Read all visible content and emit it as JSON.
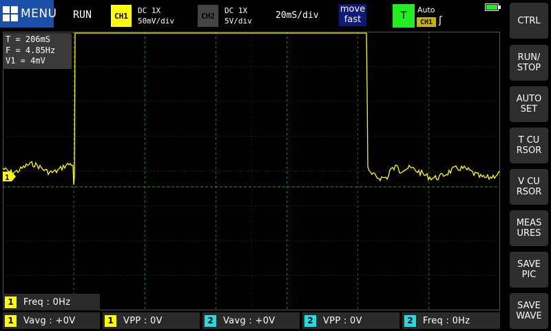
{
  "topbar": {
    "menu_label": "MENU",
    "run_state": "RUN",
    "ch1": {
      "badge": "CH1",
      "coupling": "DC  1X",
      "scale": "50mV/div",
      "color": "#ffff00"
    },
    "ch2": {
      "badge": "CH2",
      "coupling": "DC  1X",
      "scale": "5V/div",
      "color": "#444444"
    },
    "timebase": "20mS/div",
    "move": {
      "line1": "move",
      "line2": "fast"
    },
    "trigger": {
      "badge": "T",
      "mode": "Auto",
      "source": "CH1",
      "edge_icon": "rising-edge-icon"
    },
    "battery_icon": "battery-icon"
  },
  "side_buttons": [
    {
      "id": "ctrl",
      "line1": "CTRL",
      "line2": ""
    },
    {
      "id": "run-stop",
      "line1": "RUN/",
      "line2": "STOP"
    },
    {
      "id": "auto-set",
      "line1": "AUTO",
      "line2": "SET"
    },
    {
      "id": "t-cursor",
      "line1": "T CU",
      "line2": "RSOR"
    },
    {
      "id": "v-cursor",
      "line1": "V CU",
      "line2": "RSOR"
    },
    {
      "id": "measures",
      "line1": "MEAS",
      "line2": "URES"
    },
    {
      "id": "save-pic",
      "line1": "SAVE",
      "line2": "PIC"
    },
    {
      "id": "save-wave",
      "line1": "SAVE",
      "line2": "WAVE"
    }
  ],
  "measure_box": {
    "period": "T = 206mS",
    "freq": "F = 4.85Hz",
    "v1": "V1 = 4mV"
  },
  "ch1_marker": "1",
  "bottom": [
    {
      "ch": "1",
      "label": "Freq : 0Hz"
    },
    {
      "ch": "1",
      "label": "Vavg : +0V"
    },
    {
      "ch": "1",
      "label": "VPP  : 0V"
    },
    {
      "ch": "2",
      "label": "Vavg : +0V"
    },
    {
      "ch": "2",
      "label": "VPP  : 0V"
    },
    {
      "ch": "2",
      "label": "Freq : 0Hz"
    }
  ],
  "colors": {
    "ch1": "#ffff00",
    "ch2": "#22dddd",
    "grid": "#22aa22",
    "trigger_level": "#22aa22"
  }
}
